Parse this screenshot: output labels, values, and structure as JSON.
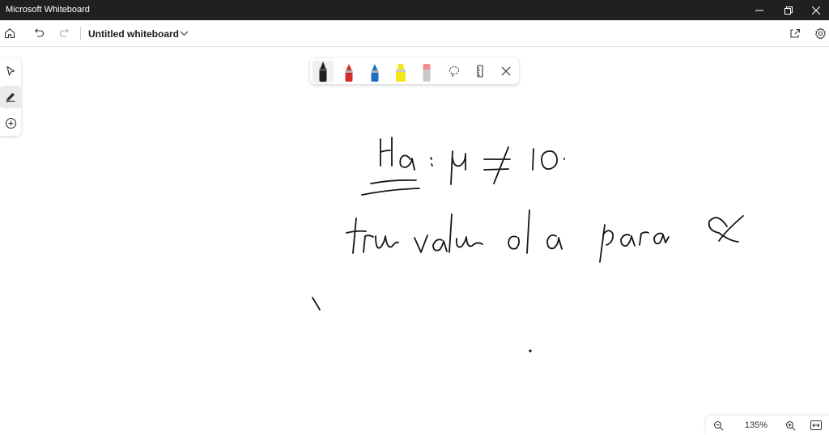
{
  "window": {
    "app_title": "Microsoft Whiteboard"
  },
  "toolbar": {
    "doc_title": "Untitled whiteboard"
  },
  "icons": {
    "home": "home-icon",
    "undo": "undo-icon",
    "redo": "redo-icon",
    "share": "share-icon",
    "settings": "gear-icon"
  },
  "pens": [
    {
      "name": "black-pen",
      "color": "#1e1e1e"
    },
    {
      "name": "red-pen",
      "color": "#d42b2b"
    },
    {
      "name": "blue-pen",
      "color": "#1c6fc4"
    },
    {
      "name": "yellow-highlighter",
      "color": "#f5e51b"
    },
    {
      "name": "eraser",
      "color": "#f08d8d"
    }
  ],
  "zoom": {
    "level": "135%"
  }
}
